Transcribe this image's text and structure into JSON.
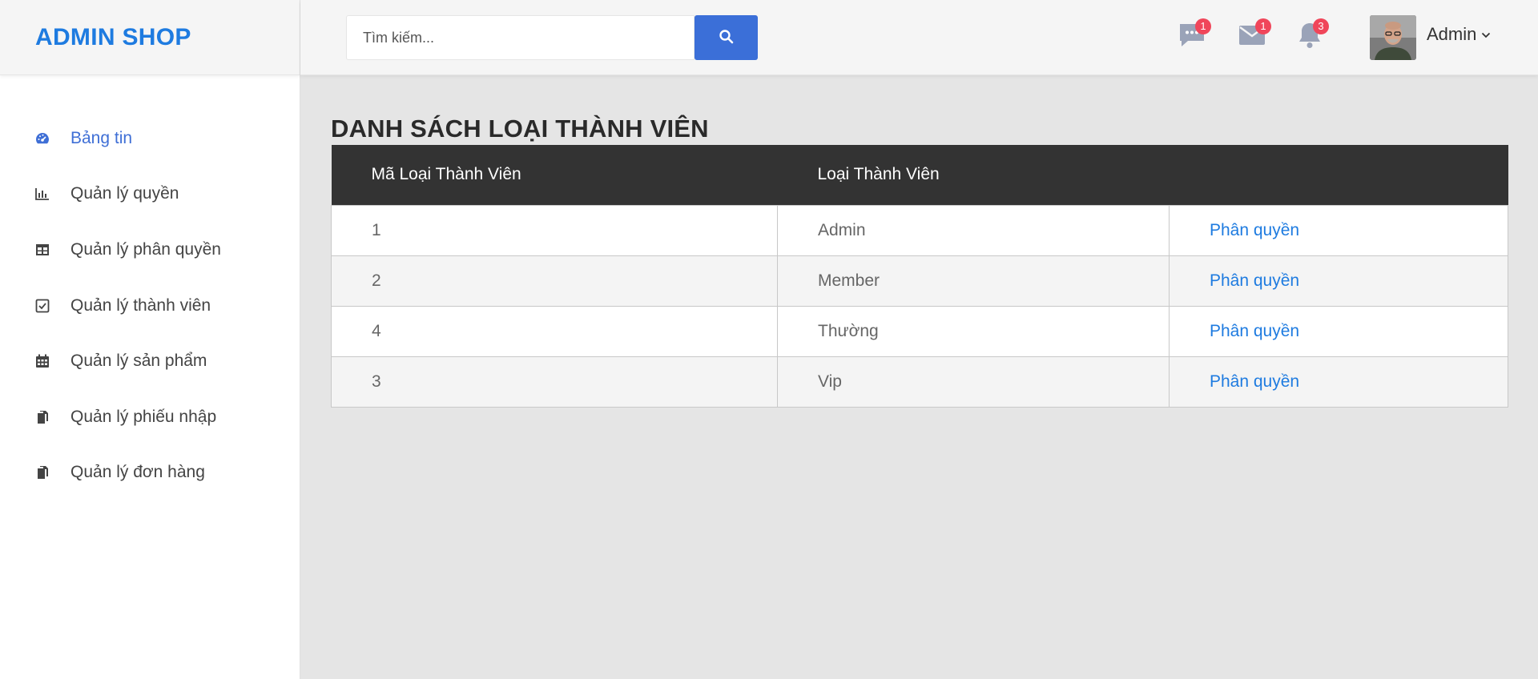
{
  "brand": "ADMIN SHOP",
  "search": {
    "placeholder": "Tìm kiếm..."
  },
  "header": {
    "icons": [
      {
        "name": "chat-icon",
        "badge": "1"
      },
      {
        "name": "mail-icon",
        "badge": "1"
      },
      {
        "name": "bell-icon",
        "badge": "3"
      }
    ],
    "user": "Admin"
  },
  "sidebar": {
    "items": [
      {
        "label": "Bảng tin",
        "icon": "dashboard-icon",
        "active": true
      },
      {
        "label": "Quản lý quyền",
        "icon": "bar-chart-icon"
      },
      {
        "label": "Quản lý phân quyền",
        "icon": "table-icon"
      },
      {
        "label": "Quản lý thành viên",
        "icon": "checkbox-icon"
      },
      {
        "label": "Quản lý sản phẩm",
        "icon": "calendar-icon"
      },
      {
        "label": "Quản lý phiếu nhập",
        "icon": "copy-icon"
      },
      {
        "label": "Quản lý đơn hàng",
        "icon": "copy-icon"
      }
    ]
  },
  "main": {
    "title": "DANH SÁCH LOẠI THÀNH VIÊN",
    "columns": [
      "Mã Loại Thành Viên",
      "Loại Thành Viên",
      ""
    ],
    "rows": [
      {
        "id": "1",
        "type": "Admin",
        "action": "Phân quyền"
      },
      {
        "id": "2",
        "type": "Member",
        "action": "Phân quyền"
      },
      {
        "id": "4",
        "type": "Thường",
        "action": "Phân quyền"
      },
      {
        "id": "3",
        "type": "Vip",
        "action": "Phân quyền"
      }
    ]
  },
  "colors": {
    "accent": "#1e7be0",
    "button": "#3b6fd8",
    "header_row": "#333333",
    "badge": "#f0465a"
  }
}
